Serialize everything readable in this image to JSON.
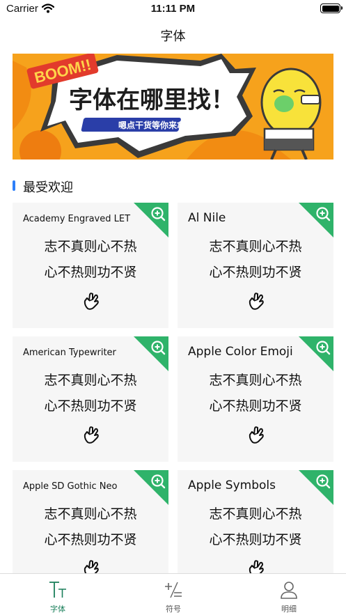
{
  "status_bar": {
    "carrier": "Carrier",
    "time": "11:11 PM"
  },
  "nav": {
    "title": "字体"
  },
  "banner": {
    "boom": "BOOM!!",
    "headline": "字体在哪里找！",
    "subline": "嗯点干货等你来拿"
  },
  "section": {
    "title": "最受欢迎"
  },
  "cards": [
    {
      "name": "Academy Engraved LET",
      "line1": "志不真则心不热",
      "line2": "心不热则功不贤"
    },
    {
      "name": "Al Nile",
      "line1": "志不真则心不热",
      "line2": "心不热则功不贤"
    },
    {
      "name": "American Typewriter",
      "line1": "志不真则心不热",
      "line2": "心不热则功不贤"
    },
    {
      "name": "Apple Color Emoji",
      "line1": "志不真则心不热",
      "line2": "心不热则功不贤"
    },
    {
      "name": "Apple SD Gothic Neo",
      "line1": "志不真则心不热",
      "line2": "心不热则功不贤"
    },
    {
      "name": "Apple Symbols",
      "line1": "志不真则心不热",
      "line2": "心不热则功不贤"
    }
  ],
  "tabs": [
    {
      "label": "字体",
      "icon": "font-size-icon",
      "active": true
    },
    {
      "label": "符号",
      "icon": "plus-minus-icon",
      "active": false
    },
    {
      "label": "明细",
      "icon": "person-icon",
      "active": false
    }
  ],
  "colors": {
    "accent_green": "#1a7f5a",
    "corner_green": "#2fb36a",
    "section_bar": "#2d7ff9",
    "banner_orange": "#f6a21c"
  }
}
